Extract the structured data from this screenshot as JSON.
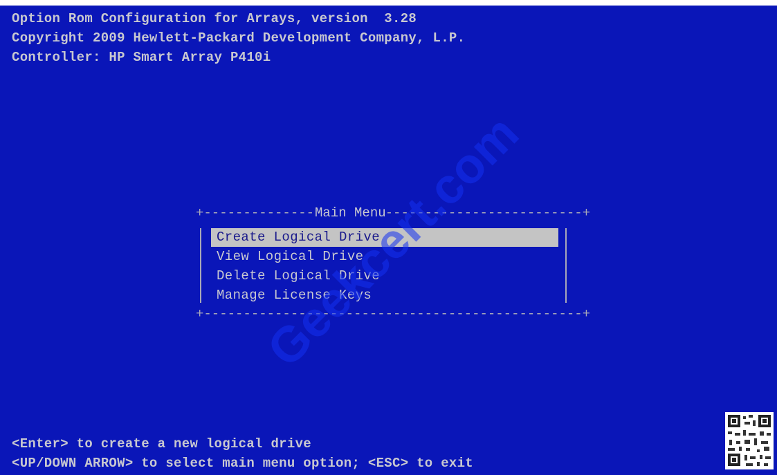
{
  "header": {
    "line1": "Option Rom Configuration for Arrays, version  3.28",
    "line2": "Copyright 2009 Hewlett-Packard Development Company, L.P.",
    "line3": "Controller: HP Smart Array P410i"
  },
  "menu": {
    "title": "Main Menu",
    "items": [
      {
        "label": "Create Logical Drive",
        "selected": true
      },
      {
        "label": "View Logical Drive",
        "selected": false
      },
      {
        "label": "Delete Logical Drive",
        "selected": false
      },
      {
        "label": "Manage License Keys",
        "selected": false
      }
    ]
  },
  "footer": {
    "hint1": "<Enter> to create a new logical drive",
    "hint2": "<UP/DOWN ARROW> to select main menu option; <ESC> to exit"
  },
  "watermark": {
    "text": "Geekcert.com"
  },
  "colors": {
    "background": "#0a16b8",
    "text": "#c8c8d0",
    "highlight_bg": "#c4c4c4",
    "highlight_text": "#1a1a8c"
  }
}
